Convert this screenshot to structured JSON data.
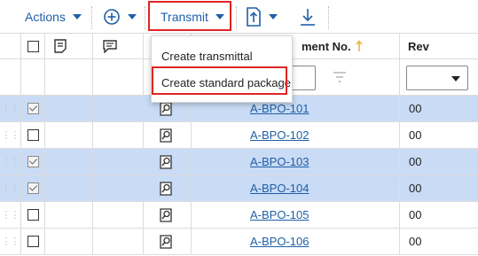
{
  "toolbar": {
    "actions_label": "Actions",
    "transmit_label": "Transmit"
  },
  "table": {
    "columns": {
      "doc_no": "ment No.",
      "rev": "Rev"
    },
    "rows": [
      {
        "doc": "A-BPO-101",
        "rev": "00",
        "checked": true
      },
      {
        "doc": "A-BPO-102",
        "rev": "00",
        "checked": false
      },
      {
        "doc": "A-BPO-103",
        "rev": "00",
        "checked": true
      },
      {
        "doc": "A-BPO-104",
        "rev": "00",
        "checked": true
      },
      {
        "doc": "A-BPO-105",
        "rev": "00",
        "checked": false
      },
      {
        "doc": "A-BPO-106",
        "rev": "00",
        "checked": false
      }
    ]
  },
  "menu": {
    "items": [
      "Create transmittal",
      "Create standard package"
    ]
  },
  "colors": {
    "accent": "#1f5fa8",
    "selected_row": "#c9dbf5",
    "highlight_box": "#e02424"
  }
}
